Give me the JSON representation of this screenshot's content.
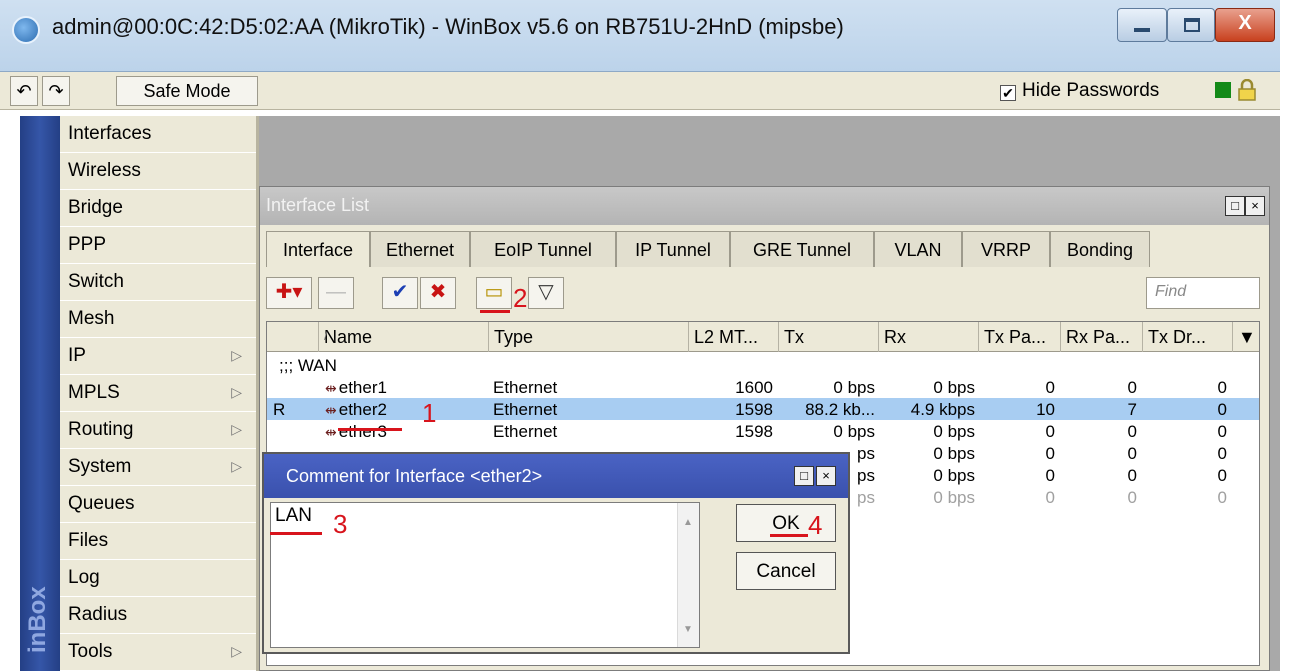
{
  "window": {
    "title": "admin@00:0C:42:D5:02:AA (MikroTik) - WinBox v5.6 on RB751U-2HnD (mipsbe)",
    "icon": "winbox-app-icon",
    "close_glyph": "X"
  },
  "toolbar": {
    "undo_icon": "↶",
    "redo_icon": "↷",
    "safe_mode_label": "Safe Mode",
    "hide_passwords_check": "✔",
    "hide_passwords_label": "Hide Passwords"
  },
  "sidebar": {
    "brand_text": "inBox",
    "items": [
      {
        "label": "Interfaces",
        "arrow": ""
      },
      {
        "label": "Wireless",
        "arrow": ""
      },
      {
        "label": "Bridge",
        "arrow": ""
      },
      {
        "label": "PPP",
        "arrow": ""
      },
      {
        "label": "Switch",
        "arrow": ""
      },
      {
        "label": "Mesh",
        "arrow": ""
      },
      {
        "label": "IP",
        "arrow": "▷"
      },
      {
        "label": "MPLS",
        "arrow": "▷"
      },
      {
        "label": "Routing",
        "arrow": "▷"
      },
      {
        "label": "System",
        "arrow": "▷"
      },
      {
        "label": "Queues",
        "arrow": ""
      },
      {
        "label": "Files",
        "arrow": ""
      },
      {
        "label": "Log",
        "arrow": ""
      },
      {
        "label": "Radius",
        "arrow": ""
      },
      {
        "label": "Tools",
        "arrow": "▷"
      }
    ]
  },
  "interface_list": {
    "title": "Interface List",
    "tabs": [
      "Interface",
      "Ethernet",
      "EoIP Tunnel",
      "IP Tunnel",
      "GRE Tunnel",
      "VLAN",
      "VRRP",
      "Bonding"
    ],
    "active_tab": "Interface",
    "find_placeholder": "Find",
    "tool_icons": {
      "add": "✚▾",
      "remove": "—",
      "enable": "✔",
      "disable": "✖",
      "comment": "▭",
      "filter": "▽"
    },
    "columns": [
      "Name",
      "Type",
      "L2 MT...",
      "Tx",
      "Rx",
      "Tx Pa...",
      "Rx Pa...",
      "Tx Dr..."
    ],
    "sort_marker": "/",
    "dropdown_glyph": "▼",
    "group_comment": ";;; WAN",
    "rows": [
      {
        "flag": "",
        "name": "ether1",
        "type": "Ethernet",
        "l2mtu": "1600",
        "tx": "0 bps",
        "rx": "0 bps",
        "txp": "0",
        "rxp": "0",
        "txd": "0",
        "selected": false
      },
      {
        "flag": "R",
        "name": "ether2",
        "type": "Ethernet",
        "l2mtu": "1598",
        "tx": "88.2 kb...",
        "rx": "4.9 kbps",
        "txp": "10",
        "rxp": "7",
        "txd": "0",
        "selected": true
      },
      {
        "flag": "",
        "name": "ether3",
        "type": "Ethernet",
        "l2mtu": "1598",
        "tx": "0 bps",
        "rx": "0 bps",
        "txp": "0",
        "rxp": "0",
        "txd": "0",
        "selected": false
      },
      {
        "flag": "",
        "name": "",
        "type": "",
        "l2mtu": "",
        "tx": "ps",
        "rx": "0 bps",
        "txp": "0",
        "rxp": "0",
        "txd": "0",
        "selected": false
      },
      {
        "flag": "",
        "name": "",
        "type": "",
        "l2mtu": "",
        "tx": "ps",
        "rx": "0 bps",
        "txp": "0",
        "rxp": "0",
        "txd": "0",
        "selected": false
      },
      {
        "flag": "",
        "name": "",
        "type": "",
        "l2mtu": "",
        "tx": "ps",
        "rx": "0 bps",
        "txp": "0",
        "rxp": "0",
        "txd": "0",
        "selected": false
      }
    ]
  },
  "comment_dialog": {
    "title": "Comment for Interface <ether2>",
    "text": "LAN",
    "ok_label": "OK",
    "cancel_label": "Cancel",
    "scroll_up": "▲",
    "scroll_down": "▼"
  },
  "annotations": {
    "step1": "1",
    "step2": "2",
    "step3": "3",
    "step4": "4"
  },
  "colors": {
    "annotation": "#d8141c",
    "selection": "#a8cdf2",
    "dialog_title": "#3a51ad",
    "sidebar_strip": "#2e4b99"
  }
}
